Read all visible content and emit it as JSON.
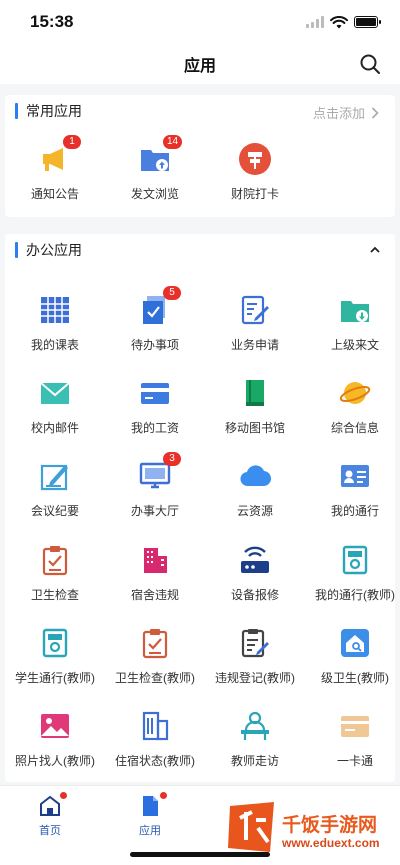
{
  "status_bar": {
    "time": "15:38"
  },
  "nav": {
    "title": "应用"
  },
  "common": {
    "title": "常用应用",
    "add_label": "点击添加",
    "apps": [
      {
        "label": "通知公告",
        "icon": "megaphone-icon",
        "badge": "1"
      },
      {
        "label": "发文浏览",
        "icon": "folder-upload-icon",
        "badge": "14"
      },
      {
        "label": "财院打卡",
        "icon": "signpost-icon",
        "badge": ""
      }
    ]
  },
  "office": {
    "title": "办公应用",
    "apps": [
      {
        "label": "我的课表",
        "icon": "timetable-icon",
        "badge": ""
      },
      {
        "label": "待办事项",
        "icon": "todo-icon",
        "badge": "5"
      },
      {
        "label": "业务申请",
        "icon": "application-form-icon",
        "badge": ""
      },
      {
        "label": "上级来文",
        "icon": "folder-download-icon",
        "badge": ""
      },
      {
        "label": "校内邮件",
        "icon": "mail-icon",
        "badge": ""
      },
      {
        "label": "我的工资",
        "icon": "salary-card-icon",
        "badge": ""
      },
      {
        "label": "移动图书馆",
        "icon": "book-icon",
        "badge": ""
      },
      {
        "label": "综合信息",
        "icon": "planet-icon",
        "badge": ""
      },
      {
        "label": "会议纪要",
        "icon": "meeting-notes-icon",
        "badge": ""
      },
      {
        "label": "办事大厅",
        "icon": "monitor-icon",
        "badge": "3"
      },
      {
        "label": "云资源",
        "icon": "cloud-icon",
        "badge": ""
      },
      {
        "label": "我的通行",
        "icon": "id-card-icon",
        "badge": ""
      },
      {
        "label": "卫生检查",
        "icon": "checklist-icon",
        "badge": ""
      },
      {
        "label": "宿舍违规",
        "icon": "building-icon",
        "badge": ""
      },
      {
        "label": "设备报修",
        "icon": "router-icon",
        "badge": ""
      },
      {
        "label": "我的通行(教师)",
        "icon": "gate-icon",
        "badge": ""
      },
      {
        "label": "学生通行(教师)",
        "icon": "gate-icon",
        "badge": ""
      },
      {
        "label": "卫生检查(教师)",
        "icon": "checklist-icon",
        "badge": ""
      },
      {
        "label": "违规登记(教师)",
        "icon": "register-icon",
        "badge": ""
      },
      {
        "label": "级卫生(教师)",
        "icon": "house-search-icon",
        "badge": ""
      },
      {
        "label": "照片找人(教师)",
        "icon": "photo-icon",
        "badge": ""
      },
      {
        "label": "住宿状态(教师)",
        "icon": "dorm-status-icon",
        "badge": ""
      },
      {
        "label": "教师走访",
        "icon": "visit-icon",
        "badge": ""
      },
      {
        "label": "一卡通",
        "icon": "card-icon",
        "badge": ""
      }
    ]
  },
  "tabs": [
    {
      "label": "首页",
      "icon": "home-icon"
    },
    {
      "label": "应用",
      "icon": "document-icon"
    }
  ],
  "watermark": {
    "brand": "千饭手游网",
    "url": "www.eduext.com"
  },
  "colors": {
    "accent": "#2a7ff0",
    "badge": "#e8302a",
    "background": "#f5f6f8"
  }
}
